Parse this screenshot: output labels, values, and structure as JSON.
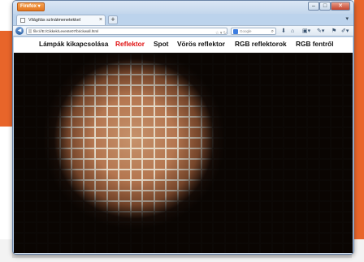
{
  "browser": {
    "app_button": "Firefox",
    "tab_title": "Világítás színátmenetekkel",
    "url": "file:///E:/Cikkek/Levente07/brickwall.html",
    "search_placeholder": "Google"
  },
  "menu": {
    "items": [
      {
        "label": "Lámpák kikapcsolása",
        "active": false
      },
      {
        "label": "Reflektor",
        "active": true
      },
      {
        "label": "Spot",
        "active": false
      },
      {
        "label": "Vörös reflektor",
        "active": false
      },
      {
        "label": "RGB reflektorok",
        "active": false
      },
      {
        "label": "RGB fentről",
        "active": false
      }
    ]
  },
  "colors": {
    "active_menu": "#e01010",
    "brick": "#a8653f",
    "mortar": "#ddd4c6",
    "firefox_orange": "#e8652a"
  }
}
